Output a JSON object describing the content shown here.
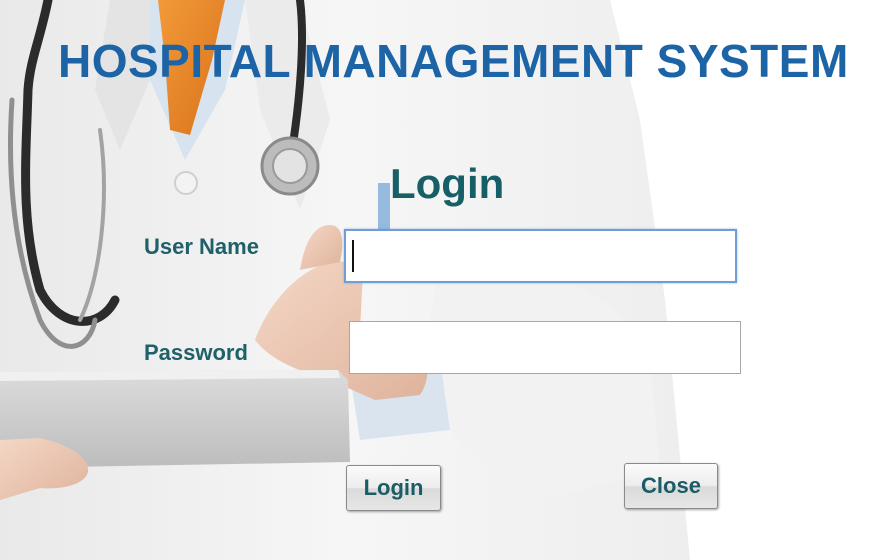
{
  "window": {
    "app_title": "HOSPITAL MANAGEMENT SYSTEM",
    "heading": "Login"
  },
  "form": {
    "username": {
      "label": "User Name",
      "value": ""
    },
    "password": {
      "label": "Password",
      "value": ""
    }
  },
  "buttons": {
    "login_label": "Login",
    "close_label": "Close"
  },
  "colors": {
    "title": "#1c64a6",
    "heading": "#175f66",
    "label": "#1f6069",
    "focus_border": "#6f9ed6"
  },
  "background": {
    "image": "doctor-with-stethoscope-holding-tablet"
  }
}
